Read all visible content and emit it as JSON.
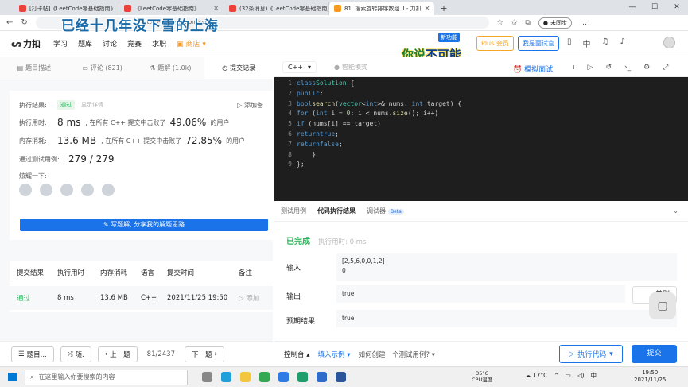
{
  "browser": {
    "tabs": [
      {
        "title": "[打卡帖]《LeetCode零基础指南》"
      },
      {
        "title": "《LeetCode零基础指南》"
      },
      {
        "title": "(32条消息)《LeetCode零基础指南》"
      },
      {
        "title": "81. 搜索旋转排序数组 II - 力扣"
      }
    ],
    "url": "tted-array-ii/submissions/",
    "profile_label": "未同步"
  },
  "overlays": {
    "top_text": "已经十几年没下雪的上海",
    "right_text_a": "你说",
    "right_text_b": "不可能"
  },
  "nav": {
    "logo": "力扣",
    "items": [
      "学习",
      "题库",
      "讨论",
      "竞赛",
      "求职"
    ],
    "shop": "商店",
    "new_feature": "新功能",
    "plus": "Plus 会员",
    "interview": "我是面试官",
    "lang": "中"
  },
  "left_tabs": [
    "题目描述",
    "评论 (821)",
    "题解 (1.0k)",
    "提交记录"
  ],
  "summary": {
    "result_label": "执行结果:",
    "result": "通过",
    "detail": "显示详情",
    "add_note": "添加备",
    "time_label": "执行用时:",
    "time": "8 ms",
    "time_text_a": ", 在所有 C++ 提交中击败了",
    "time_pct": "49.06%",
    "time_text_b": "的用户",
    "mem_label": "内存消耗:",
    "mem": "13.6 MB",
    "mem_text_a": ", 在所有 C++ 提交中击败了",
    "mem_pct": "72.85%",
    "mem_text_b": "的用户",
    "cases_label": "通过测试用例:",
    "cases": "279 / 279",
    "share_label": "炫耀一下:",
    "write_button": "写题解, 分享我的解题思路"
  },
  "submissions": {
    "headers": [
      "提交结果",
      "执行用时",
      "内存消耗",
      "语言",
      "提交时间",
      "备注"
    ],
    "rows": [
      {
        "result": "通过",
        "time": "8 ms",
        "memory": "13.6 MB",
        "lang": "C++",
        "submitted": "2021/11/25 19:50",
        "note": "添加"
      }
    ]
  },
  "left_footer": {
    "list": "题目...",
    "random": "随.",
    "prev": "上一题",
    "page": "81/2437",
    "next": "下一题"
  },
  "editor": {
    "language": "C++",
    "smart_mode": "智能模式",
    "mock": "模拟面试",
    "code_lines": [
      "class Solution {",
      "public:",
      "    bool search(vector<int>& nums, int target) {",
      "        for (int i = 0; i < nums.size(); i++)",
      "            if (nums[i] == target)",
      "                return true;",
      "        return false;",
      "    }",
      "};"
    ]
  },
  "result_panel": {
    "tabs": [
      "测试用例",
      "代码执行结果",
      "调试器"
    ],
    "beta": "Beta",
    "status": "已完成",
    "exec_time": "执行用时: 0 ms",
    "input_label": "输入",
    "input_lines": [
      "[2,5,6,0,0,1,2]",
      "0"
    ],
    "output_label": "输出",
    "output": "true",
    "expected_label": "预期结果",
    "expected": "true",
    "diff": "差别"
  },
  "editor_footer": {
    "console": "控制台",
    "example": "填入示例",
    "howto": "如何创建一个测试用例?",
    "run": "执行代码",
    "submit": "提交"
  },
  "taskbar": {
    "search_placeholder": "在这里输入你要搜索的内容",
    "cpu_temp": "35°C",
    "cpu_label": "CPU温度",
    "weather": "17°C",
    "ime": "中",
    "time": "19:50",
    "date": "2021/11/25"
  }
}
